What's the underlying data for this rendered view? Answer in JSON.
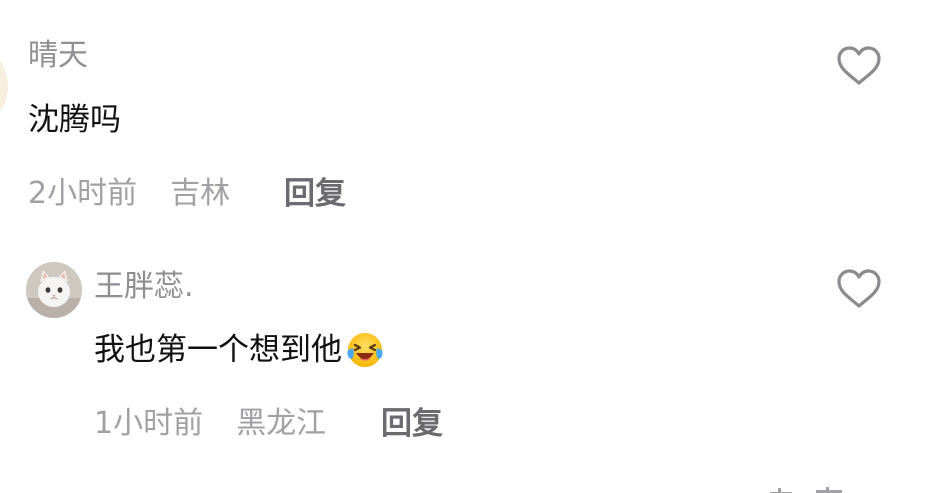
{
  "comments": [
    {
      "username": "晴天",
      "body": "沈腾吗",
      "time": "2小时前",
      "location": "吉林",
      "reply_label": "回复"
    },
    {
      "username": "王胖蕊.",
      "body": "我也第一个想到他",
      "body_emoji": "laughing-crying-emoji",
      "time": "1小时前",
      "location": "黑龙江",
      "reply_label": "回复"
    }
  ],
  "icons": {
    "like": "heart-outline-icon"
  },
  "colors": {
    "username": "#8e8e93",
    "body": "#111111",
    "meta": "#a0a0a5",
    "reply": "#6a6a6f",
    "icon": "#8a8a8f"
  }
}
